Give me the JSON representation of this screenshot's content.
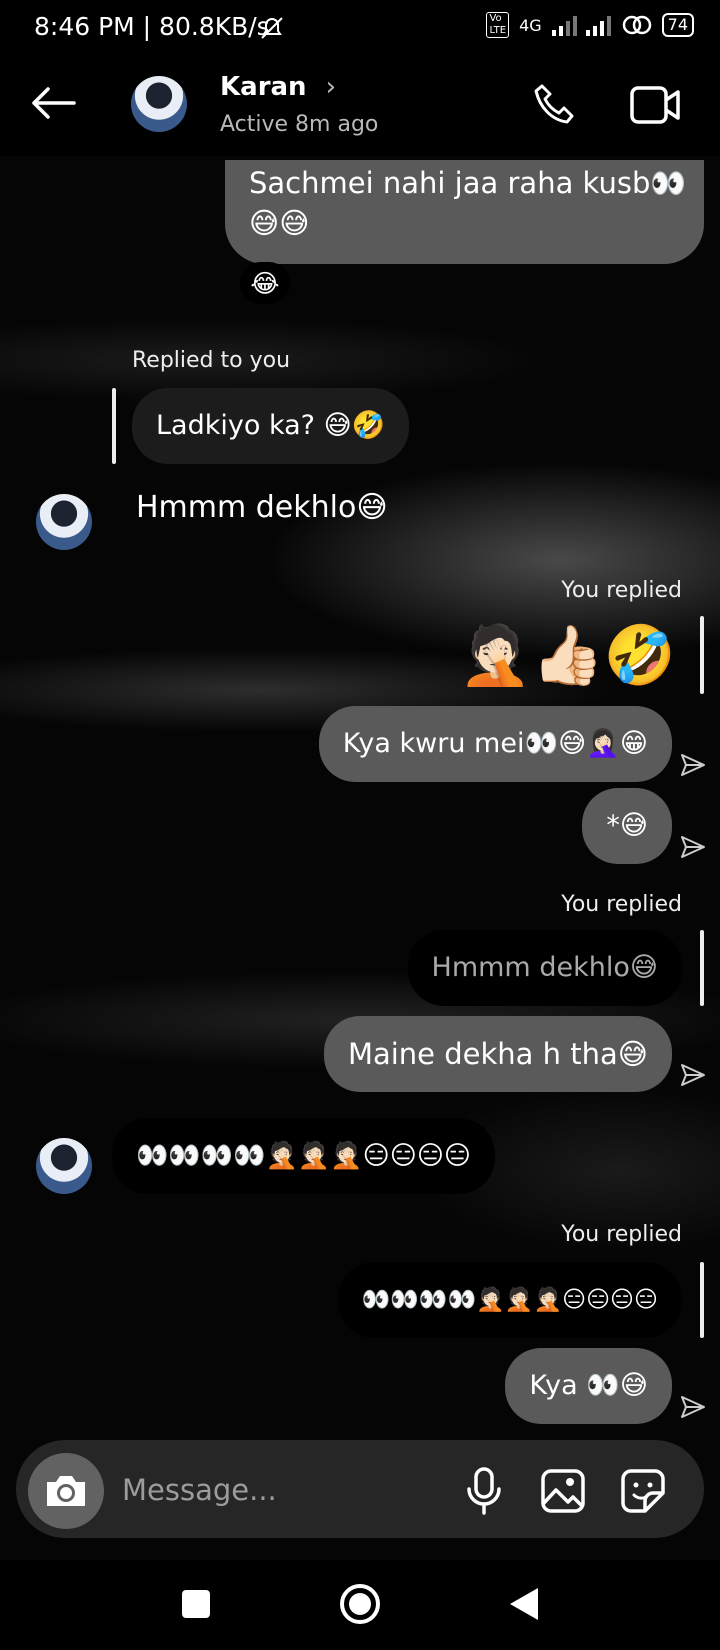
{
  "status_bar": {
    "time": "8:46 PM | 80.8KB/s",
    "network": "4G",
    "battery": "74"
  },
  "header": {
    "name": "Karan",
    "chevron": "›",
    "status": "Active 8m ago"
  },
  "messages": {
    "m1_line1": "Sachmei nahi jaa raha kusb👀",
    "m1_line2": "😅😅",
    "m1_reaction": "😂",
    "m2_label": "Replied to you",
    "m2_quote": "Ladkiyo ka? 😅🤣",
    "m3_text": "Hmmm dekhlo😅",
    "m4_label": "You replied",
    "m4_emojis": "🤦🏻👍🏻🤣",
    "m5_text": "Kya kwru mei👀😅🤦🏻‍♀️😁",
    "m6_text": "*😅",
    "m7_label": "You replied",
    "m7_quote": "Hmmm dekhlo😅",
    "m8_text": "Maine dekha h tha😅",
    "m9_text": "👀👀👀👀🤦🏻🤦🏻🤦🏻😑😑😑😑",
    "m10_label": "You replied",
    "m10_quote": "👀👀👀👀🤦🏻🤦🏻🤦🏻😑😑😑😑",
    "m11_text": "Kya 👀😅"
  },
  "composer": {
    "placeholder": "Message..."
  },
  "icons": {
    "back": "arrow-left",
    "call": "phone",
    "video": "video-camera",
    "camera": "camera",
    "mic": "microphone",
    "gallery": "image",
    "sticker": "sticker",
    "sent": "paper-plane",
    "nav_recent": "square",
    "nav_home": "circle",
    "nav_back": "triangle"
  }
}
